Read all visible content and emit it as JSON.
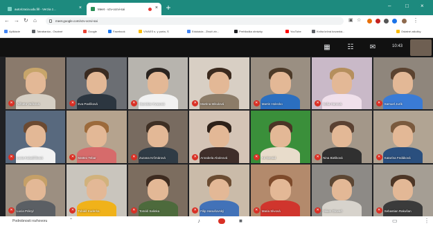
{
  "browser": {
    "tabs": [
      {
        "title": "autorizacia.udu.fill - Verzia z...",
        "active": false
      },
      {
        "title": "Meet - vzv-ocrvi-sai",
        "active": true
      }
    ],
    "url": "meet.google.com/vzv-ocrvi-sai",
    "bookmarks": [
      {
        "label": "Aplikácie",
        "icon_color": "#4285f4"
      },
      {
        "label": "Tatrabanka - Osobné",
        "icon_color": "#5f6368"
      },
      {
        "label": "Google",
        "icon_color": "#ea4335"
      },
      {
        "label": "Facebook",
        "icon_color": "#1877f2"
      },
      {
        "label": "VIVAES s. y porta, S",
        "icon_color": "#fbbc05"
      },
      {
        "label": "Edukácia - Zboží ziv...",
        "icon_color": "#4285f4"
      },
      {
        "label": "Prehliadka obrázky",
        "icon_color": "#202124"
      },
      {
        "label": "YouTube",
        "icon_color": "#ff0000"
      },
      {
        "label": "Kniha krčná kovanká...",
        "icon_color": "#5f6368"
      },
      {
        "label": "Ostatné záložky",
        "icon_color": "#fbbc05"
      }
    ]
  },
  "meet": {
    "clock": "10:43",
    "participants": [
      {
        "name": "Alžbeta Vašková",
        "bg": "#8a7a6c",
        "hair": "#c7a56a",
        "shirt": "#d6cfc4"
      },
      {
        "name": "Eva Pavlíková",
        "bg": "#6b6e73",
        "hair": "#3a2b21",
        "shirt": "#2c3640"
      },
      {
        "name": "Stanislav Kvasová",
        "bg": "#b7b4ae",
        "hair": "#2a2420",
        "shirt": "#f1f1f1"
      },
      {
        "name": "Martina Mikulová",
        "bg": "#d8cfc4",
        "hair": "#3b2a1e",
        "shirt": "#8c7c68"
      },
      {
        "name": "Martin Holecko",
        "bg": "#9a8f82",
        "hair": "#4c3a28",
        "shirt": "#2b6fc0"
      },
      {
        "name": "Sofia Hanová",
        "bg": "#c9b9c8",
        "hair": "#b58f5d",
        "shirt": "#f0e0eb"
      },
      {
        "name": "Samuel Jurík",
        "bg": "#8f867c",
        "hair": "#5b4330",
        "shirt": "#3a7bd5"
      },
      {
        "name": "Lucia Kubaščíková",
        "bg": "#58697e",
        "hair": "#6b4a32",
        "shirt": "#f2f2f2"
      },
      {
        "name": "Matteo Tebar",
        "bg": "#b5a38e",
        "hair": "#9c6a3b",
        "shirt": "#d66b6b"
      },
      {
        "name": "Zuzana Krčmárová",
        "bg": "#786b60",
        "hair": "#3e2f24",
        "shirt": "#2f3b45"
      },
      {
        "name": "Annabela Aboleová",
        "bg": "#d4c4b6",
        "hair": "#2e2119",
        "shirt": "#3f2e2a"
      },
      {
        "name": "Ari Gerald",
        "bg": "#3a8f3a",
        "hair": "#4a3526",
        "shirt": "#e8dccb"
      },
      {
        "name": "Nina Bieliková",
        "bg": "#a39789",
        "hair": "#5a4132",
        "shirt": "#303030"
      },
      {
        "name": "Katarína Fedáková",
        "bg": "#b1a493",
        "hair": "#7a5a3e",
        "shirt": "#2a4f7e"
      },
      {
        "name": "Lucia Prikryl",
        "bg": "#9c8f81",
        "hair": "#c5a068",
        "shirt": "#5b5f64"
      },
      {
        "name": "Tobiáš Kuderka",
        "bg": "#c9c5bd",
        "hair": "#d1b27d",
        "shirt": "#f0b21a"
      },
      {
        "name": "Tomáš Salinka",
        "bg": "#7c6d5f",
        "hair": "#3d2b20",
        "shirt": "#4d6a3c"
      },
      {
        "name": "Filip Hanušovský",
        "bg": "#cabba9",
        "hair": "#6b4c32",
        "shirt": "#4272b8"
      },
      {
        "name": "Maria Slivová",
        "bg": "#b38a6c",
        "hair": "#7d4a2b",
        "shirt": "#d0352d"
      },
      {
        "name": "Viliam Gloverl",
        "bg": "#8d8a86",
        "hair": "#5c4633",
        "shirt": "#d7d3cc"
      },
      {
        "name": "Sebastian Rakušan",
        "bg": "#a59e94",
        "hair": "#4d3626",
        "shirt": "#3b3b3b"
      }
    ]
  },
  "bottom": {
    "details_label": "Podrobnosti rozhovoru"
  }
}
